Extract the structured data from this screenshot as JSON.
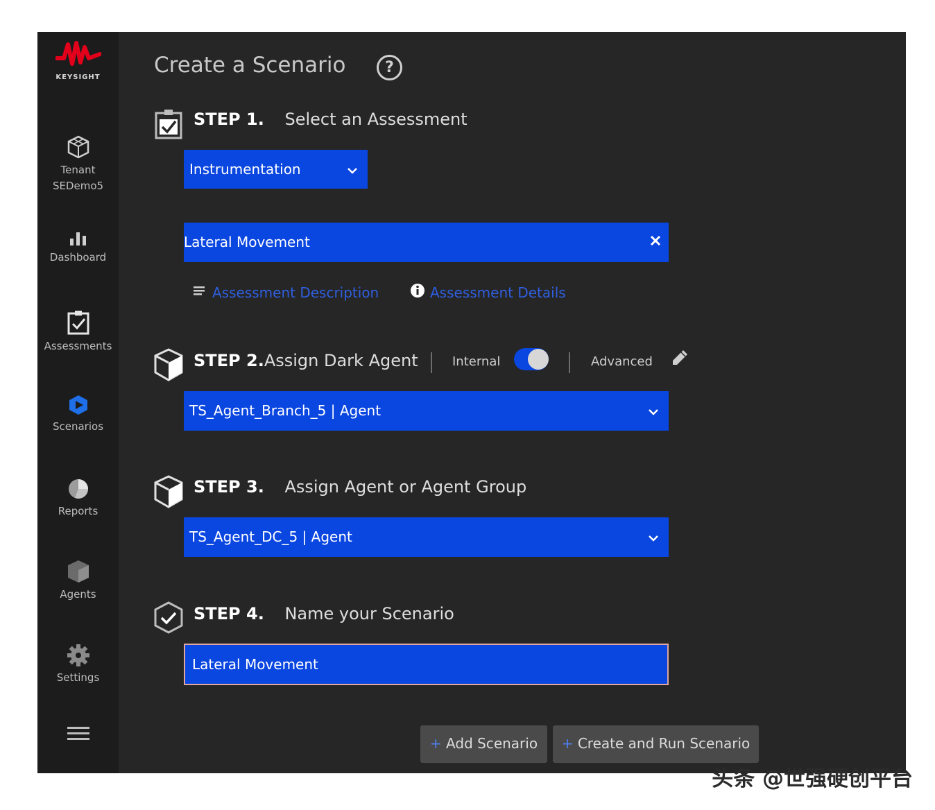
{
  "brand": {
    "name": "KEYSIGHT",
    "accent": "#e3001b"
  },
  "colors": {
    "primary": "#0a46e0",
    "sidebar": "#1c1c1c",
    "main": "#262626"
  },
  "sidebar": {
    "items": [
      {
        "label": "Tenant\nSEDemo5",
        "icon": "cube-icon"
      },
      {
        "label": "Dashboard",
        "icon": "bar-chart-icon"
      },
      {
        "label": "Assessments",
        "icon": "clipboard-check-icon"
      },
      {
        "label": "Scenarios",
        "icon": "play-hexagon-icon"
      },
      {
        "label": "Reports",
        "icon": "pie-chart-icon"
      },
      {
        "label": "Agents",
        "icon": "box-icon"
      },
      {
        "label": "Settings",
        "icon": "gear-icon"
      }
    ],
    "menu_icon": "hamburger-icon"
  },
  "page": {
    "title": "Create a Scenario",
    "help_glyph": "?"
  },
  "step1": {
    "number": "STEP 1.",
    "description": "Select an Assessment",
    "category_select": "Instrumentation",
    "assessment_value": "Lateral Movement",
    "links": {
      "description": "Assessment Description",
      "details": "Assessment Details"
    }
  },
  "step2": {
    "number": "STEP 2.",
    "description": "Assign Dark Agent",
    "toggle_label": "Internal",
    "toggle_on": true,
    "advanced_label": "Advanced",
    "agent_select": "TS_Agent_Branch_5 | Agent"
  },
  "step3": {
    "number": "STEP 3.",
    "description": "Assign Agent or Agent Group",
    "agent_select": "TS_Agent_DC_5 | Agent"
  },
  "step4": {
    "number": "STEP 4.",
    "description": "Name your Scenario",
    "name_value": "Lateral Movement"
  },
  "actions": {
    "add_label": "Add Scenario",
    "create_run_label": "Create and Run Scenario",
    "plus_glyph": "+"
  },
  "watermark": "头条 @世强硬创平台"
}
